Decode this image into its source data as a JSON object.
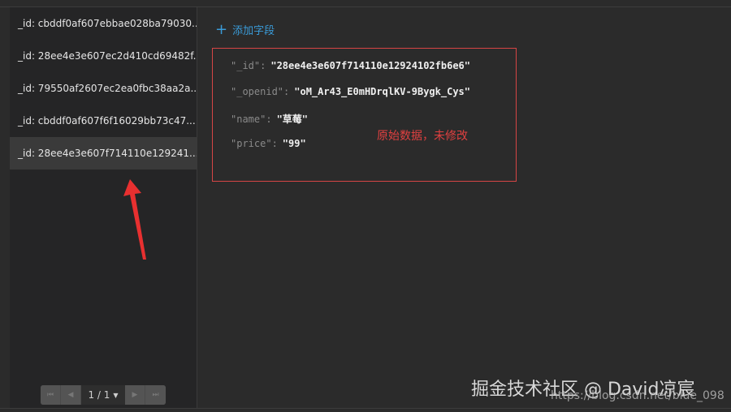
{
  "records": [
    "_id: cbddf0af607ebbae028ba79030...",
    "_id: 28ee4e3e607ec2d410cd69482f...",
    "_id: 79550af2607ec2ea0fbc38aa2a...",
    "_id: cbddf0af607f6f16029bb73c47...",
    "_id: 28ee4e3e607f714110e129241..."
  ],
  "pager": {
    "label": "1 / 1"
  },
  "add_field": "添加字段",
  "fields": [
    {
      "key": "\"_id\":",
      "value": "\"28ee4e3e607f714110e12924102fb6e6\""
    },
    {
      "key": "\"_openid\":",
      "value": "\"oM_Ar43_E0mHDrqlKV-9Bygk_Cys\""
    },
    {
      "key": "\"name\":",
      "value": "\"草莓\""
    },
    {
      "key": "\"price\":",
      "value": "\"99\""
    }
  ],
  "annotation": "原始数据，未修改",
  "watermark": "掘金技术社区 @ David凉宸",
  "watermark_url": "https://blog.csdn.net/blue_098",
  "colors": {
    "accent": "#3a9bd8",
    "annotation": "#e04040"
  }
}
